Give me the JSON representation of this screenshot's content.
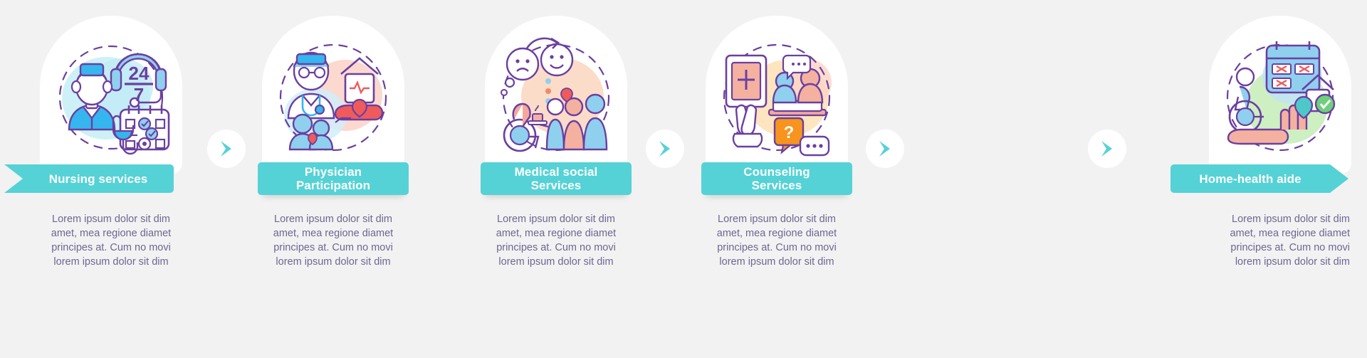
{
  "page": {
    "title": "Home care services infographic",
    "background_color": "#f2f2f2",
    "accent_color": "#55d2d6",
    "banner_text_color": "#ffffff",
    "body_text_color": "#6f6691",
    "card_color": "#ffffff"
  },
  "steps": [
    {
      "index": 1,
      "label": "Nursing services",
      "icon": "nurse-headset-calendar-icon",
      "description": "Lorem ipsum dolor sit dim amet, mea regione diamet principes at. Cum no movi lorem ipsum dolor sit dim"
    },
    {
      "index": 2,
      "label": "Physician Participation",
      "label_line1": "Physician",
      "label_line2": "Participation",
      "icon": "physician-home-heartbeat-icon",
      "description": "Lorem ipsum dolor sit dim amet, mea regione diamet principes at. Cum no movi lorem ipsum dolor sit dim"
    },
    {
      "index": 3,
      "label": "Medical social Services",
      "label_line1": "Medical social",
      "label_line2": "Services",
      "icon": "social-support-wheelchair-icon",
      "description": "Lorem ipsum dolor sit dim amet, mea regione diamet principes at. Cum no movi lorem ipsum dolor sit dim"
    },
    {
      "index": 4,
      "label": "Counseling Services",
      "label_line1": "Counseling",
      "label_line2": "Services",
      "icon": "counseling-chat-bible-icon",
      "description": "Lorem ipsum dolor sit dim amet, mea regione diamet principes at. Cum no movi lorem ipsum dolor sit dim"
    },
    {
      "index": 5,
      "label": "Home-health aide",
      "icon": "home-health-aide-calendar-icon",
      "description": "Lorem ipsum dolor sit dim amet, mea regione diamet principes at. Cum no movi lorem ipsum dolor sit dim"
    }
  ],
  "connectors": [
    {
      "index": 1,
      "icon": "chevron-right-arrow-icon"
    },
    {
      "index": 2,
      "icon": "chevron-right-arrow-icon"
    },
    {
      "index": 3,
      "icon": "chevron-right-arrow-icon"
    },
    {
      "index": 4,
      "icon": "chevron-right-arrow-icon"
    }
  ]
}
